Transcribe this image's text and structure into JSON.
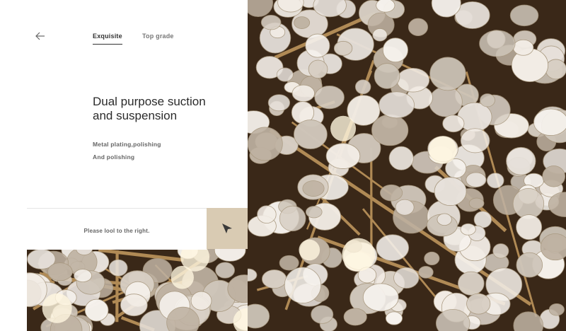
{
  "nav": {
    "back_icon": "arrow-left-icon",
    "tabs": [
      {
        "label": "Exquisite",
        "active": true
      },
      {
        "label": "Top grade",
        "active": false
      }
    ]
  },
  "content": {
    "title_line1": "Dual purpose suction",
    "title_line2": "and suspension",
    "feature_1": "Metal plating,polishing",
    "feature_2": "And polishing"
  },
  "hint": {
    "text": "Please lool to the right.",
    "button_icon": "cursor-pointer-icon"
  },
  "colors": {
    "accent_button": "#d9cbb3",
    "background": "#ffffff",
    "text_dark": "#2b2b2b"
  }
}
